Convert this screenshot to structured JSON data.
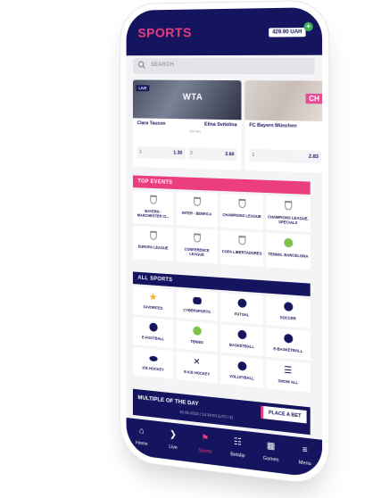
{
  "header": {
    "title": "SPORTS",
    "balance": "429.90 UAH",
    "plus_icon": "plus-icon"
  },
  "search": {
    "placeholder": "SEARCH",
    "icon": "search-icon"
  },
  "live_cards": [
    {
      "badge": "LIVE",
      "banner": "WTA",
      "team1": "Clara Tauson",
      "team2": "Elina Svitolina",
      "set_label": "Set 1   1",
      "set_label2": "3rd Set",
      "odds": [
        {
          "k": "1",
          "v": "1.30"
        },
        {
          "k": "2",
          "v": "3.60"
        }
      ]
    },
    {
      "badge": "",
      "banner": "CH",
      "team1": "FC Bayern München",
      "team2": "",
      "odds": [
        {
          "k": "1",
          "v": "2.83"
        },
        {
          "k": "",
          "v": ""
        }
      ]
    }
  ],
  "top_events": {
    "title": "TOP EVENTS",
    "items": [
      {
        "label": "BAYERN - MANCHESTER CI...",
        "icon": "trophy-icon"
      },
      {
        "label": "INTER - BENFICA",
        "icon": "trophy-icon"
      },
      {
        "label": "CHAMPIONS LEAGUE",
        "icon": "trophy-icon"
      },
      {
        "label": "CHAMPIONS LEAGUE. SPECIALS",
        "icon": "trophy-icon"
      },
      {
        "label": "EUROPA LEAGUE",
        "icon": "trophy-icon"
      },
      {
        "label": "CONFERENCE LEAGUE",
        "icon": "trophy-icon"
      },
      {
        "label": "COPA LIBERTADORES",
        "icon": "trophy-icon"
      },
      {
        "label": "TENNIS. BARCELONA",
        "icon": "tennis-ball-icon"
      }
    ]
  },
  "all_sports": {
    "title": "ALL SPORTS",
    "items": [
      {
        "label": "FAVORITES",
        "icon": "star-icon"
      },
      {
        "label": "CYBERSPORTS",
        "icon": "gamepad-icon"
      },
      {
        "label": "FUTSAL",
        "icon": "soccer-ball-icon"
      },
      {
        "label": "SOCCER",
        "icon": "soccer-ball-icon"
      },
      {
        "label": "E-FOOTBALL",
        "icon": "soccer-ball-icon"
      },
      {
        "label": "TENNIS",
        "icon": "tennis-ball-icon"
      },
      {
        "label": "BASKETBALL",
        "icon": "basketball-icon"
      },
      {
        "label": "E-BASKETBALL",
        "icon": "basketball-icon"
      },
      {
        "label": "ICE HOCKEY",
        "icon": "puck-icon"
      },
      {
        "label": "E-ICE HOCKEY",
        "icon": "hockey-sticks-icon"
      },
      {
        "label": "VOLLEYBALL",
        "icon": "volleyball-icon"
      },
      {
        "label": "SHOW ALL",
        "icon": "list-icon"
      }
    ]
  },
  "motd": {
    "title": "MULTIPLE OF THE DAY",
    "time": "15.06.2023 | 14:34:03 (UTC+3)",
    "button": "PLACE A BET"
  },
  "nav": [
    {
      "label": "Home",
      "icon": "home-icon",
      "active": false
    },
    {
      "label": "Live",
      "icon": "live-icon",
      "active": false
    },
    {
      "label": "Sports",
      "icon": "sports-icon",
      "active": true
    },
    {
      "label": "Betslip",
      "icon": "betslip-icon",
      "active": false
    },
    {
      "label": "Games",
      "icon": "games-icon",
      "active": false
    },
    {
      "label": "Menu",
      "icon": "menu-icon",
      "active": false
    }
  ],
  "colors": {
    "navy": "#15145e",
    "pink": "#ea3e7e",
    "bg": "#f4f4f6"
  }
}
